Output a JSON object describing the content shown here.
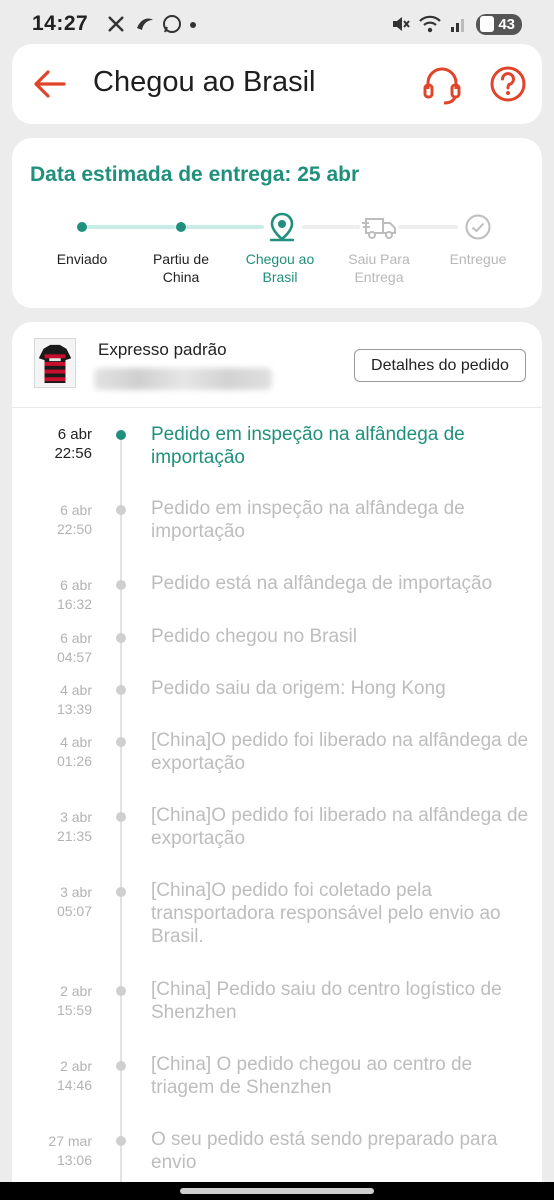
{
  "status_bar": {
    "time": "14:27",
    "battery": "43",
    "icons": [
      "x-icon",
      "moon-icon",
      "whatsapp-icon",
      "dot-icon",
      "mute-icon",
      "wifi-icon",
      "signal-icon",
      "battery-icon"
    ]
  },
  "header": {
    "title": "Chegou ao Brasil",
    "accent_color": "#e0442a"
  },
  "progress": {
    "estimate": "Data estimada de entrega: 25 abr",
    "accent_color": "#20907c",
    "steps": [
      {
        "label": "Enviado",
        "state": "done"
      },
      {
        "label": "Partiu de China",
        "state": "done"
      },
      {
        "label": "Chegou ao Brasil",
        "state": "current"
      },
      {
        "label": "Saiu Para Entrega",
        "state": "future"
      },
      {
        "label": "Entregue",
        "state": "future"
      }
    ]
  },
  "order": {
    "shipping_method": "Expresso padrão",
    "details_button": "Detalhes do pedido",
    "events": [
      {
        "date": "6 abr",
        "time": "22:56",
        "text": "Pedido em inspeção na alfândega de importação"
      },
      {
        "date": "6 abr",
        "time": "22:50",
        "text": "Pedido em inspeção na alfândega de importação"
      },
      {
        "date": "6 abr",
        "time": "16:32",
        "text": "Pedido está na alfândega de importação"
      },
      {
        "date": "6 abr",
        "time": "04:57",
        "text": "Pedido chegou no Brasil"
      },
      {
        "date": "4 abr",
        "time": "13:39",
        "text": "Pedido saiu da origem: Hong Kong"
      },
      {
        "date": "4 abr",
        "time": "01:26",
        "text": "[China]O pedido foi liberado na alfândega de exportação"
      },
      {
        "date": "3 abr",
        "time": "21:35",
        "text": "[China]O pedido foi liberado na alfândega de exportação"
      },
      {
        "date": "3 abr",
        "time": "05:07",
        "text": "[China]O pedido foi coletado pela transportadora responsável pelo envio ao Brasil."
      },
      {
        "date": "2 abr",
        "time": "15:59",
        "text": "[China] Pedido saiu do centro logístico de Shenzhen"
      },
      {
        "date": "2 abr",
        "time": "14:46",
        "text": "[China] O pedido chegou ao centro de triagem de Shenzhen"
      },
      {
        "date": "27 mar",
        "time": "13:06",
        "text": "O seu pedido está sendo preparado para envio"
      }
    ]
  }
}
